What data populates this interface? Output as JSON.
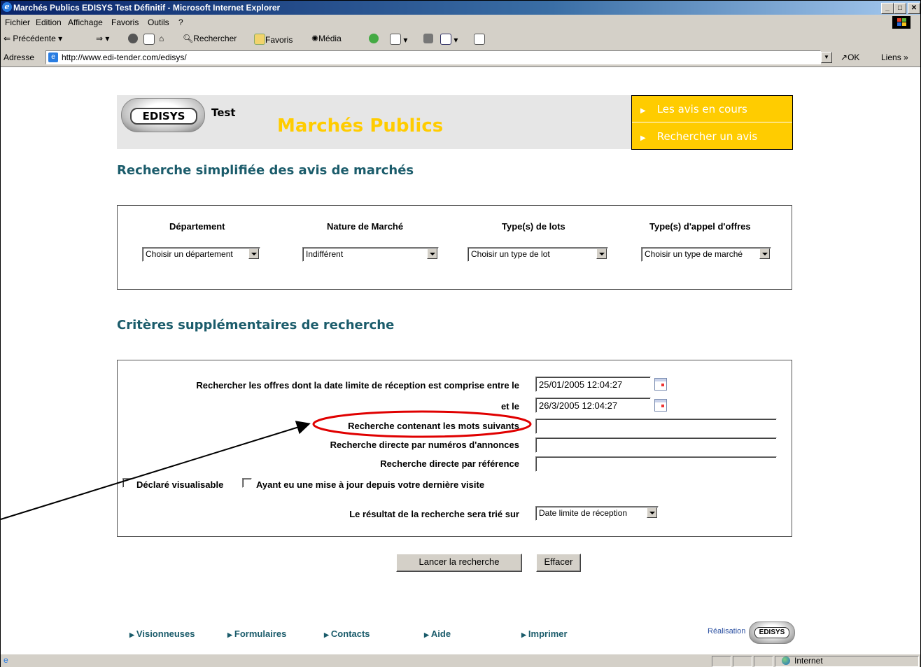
{
  "window": {
    "title": "Marchés Publics EDISYS Test Définitif - Microsoft Internet Explorer",
    "controls": [
      "_",
      "□",
      "✕"
    ]
  },
  "menubar": {
    "items": [
      "Fichier",
      "Edition",
      "Affichage",
      "Favoris",
      "Outils",
      "?"
    ]
  },
  "toolbar": {
    "back_label": "Précédente",
    "search_label": "Rechercher",
    "favorites_label": "Favoris",
    "media_label": "Média"
  },
  "addressbar": {
    "label": "Adresse",
    "url": "http://www.edi-tender.com/edisys/",
    "go_label": "OK",
    "links_label": "Liens »"
  },
  "header": {
    "logo_text": "EDISYS",
    "test_label": "Test",
    "brand": "Marchés Publics",
    "nav": [
      "Les avis en cours",
      "Rechercher un avis"
    ]
  },
  "simple_search": {
    "heading": "Recherche simplifiée des avis de marchés",
    "columns": [
      {
        "label": "Département",
        "value": "Choisir un département"
      },
      {
        "label": "Nature de Marché",
        "value": "Indifférent"
      },
      {
        "label": "Type(s) de lots",
        "value": "Choisir un type de lot"
      },
      {
        "label": "Type(s) d'appel d'offres",
        "value": "Choisir un type de marché"
      }
    ]
  },
  "extra_search": {
    "heading": "Critères supplémentaires de recherche",
    "date_from_label": "Rechercher les offres dont la date limite de réception est comprise entre le",
    "date_from_value": "25/01/2005 12:04:27",
    "date_to_label": "et le",
    "date_to_value": "26/3/2005 12:04:27",
    "keywords_label": "Recherche contenant les mots suivants",
    "keywords_value": "",
    "announce_label": "Recherche directe par numéros d'annonces",
    "announce_value": "",
    "reference_label": "Recherche directe par référence",
    "reference_value": "",
    "check_visible_label": "Déclaré visualisable",
    "check_visible_checked": false,
    "check_updated_label": "Ayant eu une mise à jour depuis votre dernière visite",
    "check_updated_checked": false,
    "sort_label": "Le résultat de la recherche sera trié sur",
    "sort_value": "Date limite de réception"
  },
  "actions": {
    "search_button": "Lancer la recherche",
    "clear_button": "Effacer"
  },
  "footer": {
    "links": [
      "Visionneuses",
      "Formulaires",
      "Contacts",
      "Aide",
      "Imprimer"
    ],
    "credit": "Réalisation",
    "logo_text": "EDISYS"
  },
  "statusbar": {
    "zone": "Internet"
  },
  "annotation": {
    "color": "#e00000"
  }
}
